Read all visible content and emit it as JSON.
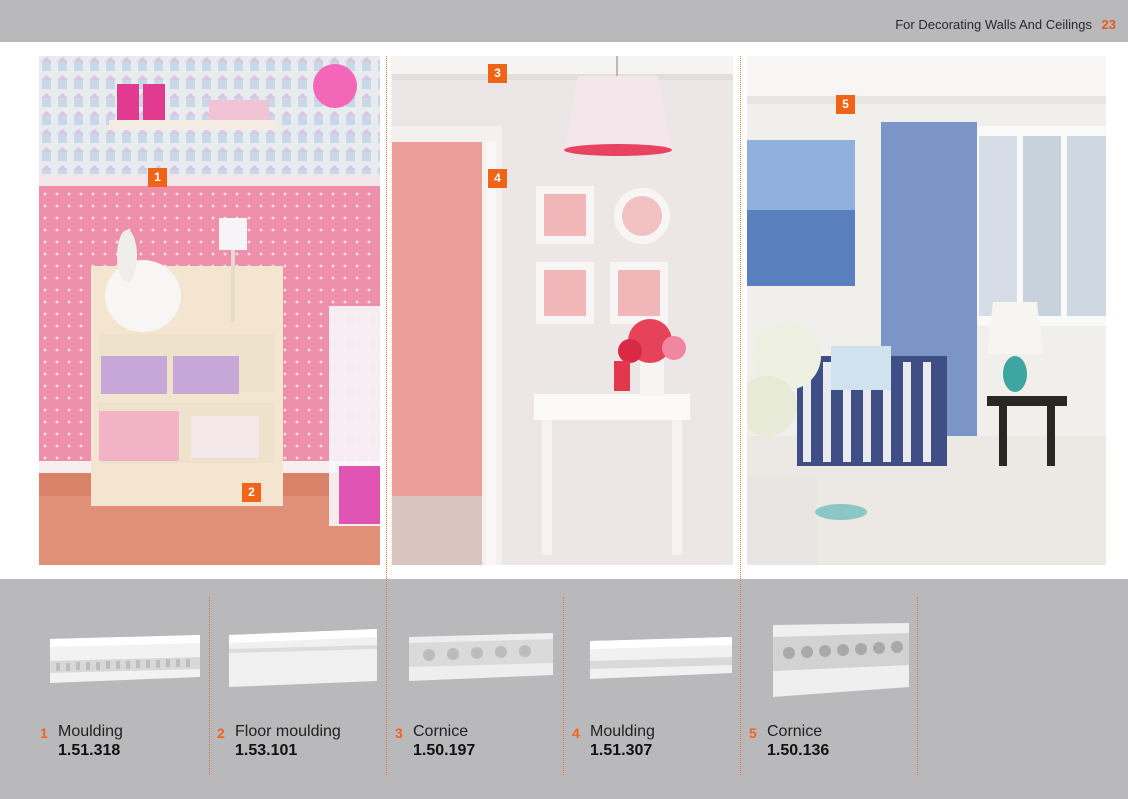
{
  "header": {
    "title": "For Decorating Walls And Ceilings",
    "page_number": "23"
  },
  "markers": [
    "1",
    "2",
    "3",
    "4",
    "5"
  ],
  "products": [
    {
      "number": "1",
      "name": "Moulding",
      "code": "1.51.318",
      "icon": "moulding-profile-icon"
    },
    {
      "number": "2",
      "name": "Floor moulding",
      "code": "1.53.101",
      "icon": "floor-moulding-profile-icon"
    },
    {
      "number": "3",
      "name": "Cornice",
      "code": "1.50.197",
      "icon": "cornice-profile-icon"
    },
    {
      "number": "4",
      "name": "Moulding",
      "code": "1.51.307",
      "icon": "moulding-profile-icon"
    },
    {
      "number": "5",
      "name": "Cornice",
      "code": "1.50.136",
      "icon": "cornice-profile-icon"
    }
  ],
  "colors": {
    "accent": "#f06418",
    "background": "#b9b8ba",
    "paper": "#ffffff"
  }
}
